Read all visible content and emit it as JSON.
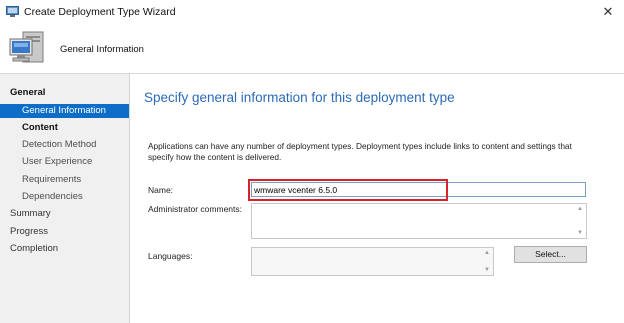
{
  "window": {
    "title": "Create Deployment Type Wizard",
    "close_glyph": "✕"
  },
  "header": {
    "title": "General Information",
    "icon": "computer-icon"
  },
  "nav": {
    "items": [
      {
        "label": "General"
      },
      {
        "label": "General Information"
      },
      {
        "label": "Content"
      },
      {
        "label": "Detection Method"
      },
      {
        "label": "User Experience"
      },
      {
        "label": "Requirements"
      },
      {
        "label": "Dependencies"
      },
      {
        "label": "Summary"
      },
      {
        "label": "Progress"
      },
      {
        "label": "Completion"
      }
    ]
  },
  "main": {
    "heading": "Specify general information for this deployment type",
    "description": "Applications can have any number of deployment types. Deployment types include links to content and settings that specify how the content is delivered.",
    "name_label": "Name:",
    "name_value": "wmware vcenter 6.5.0",
    "admin_comments_label": "Administrator comments:",
    "languages_label": "Languages:",
    "select_button": "Select..."
  },
  "colors": {
    "accent": "#0e6ec7",
    "heading": "#2b6bb7",
    "highlight": "#d8232a"
  }
}
